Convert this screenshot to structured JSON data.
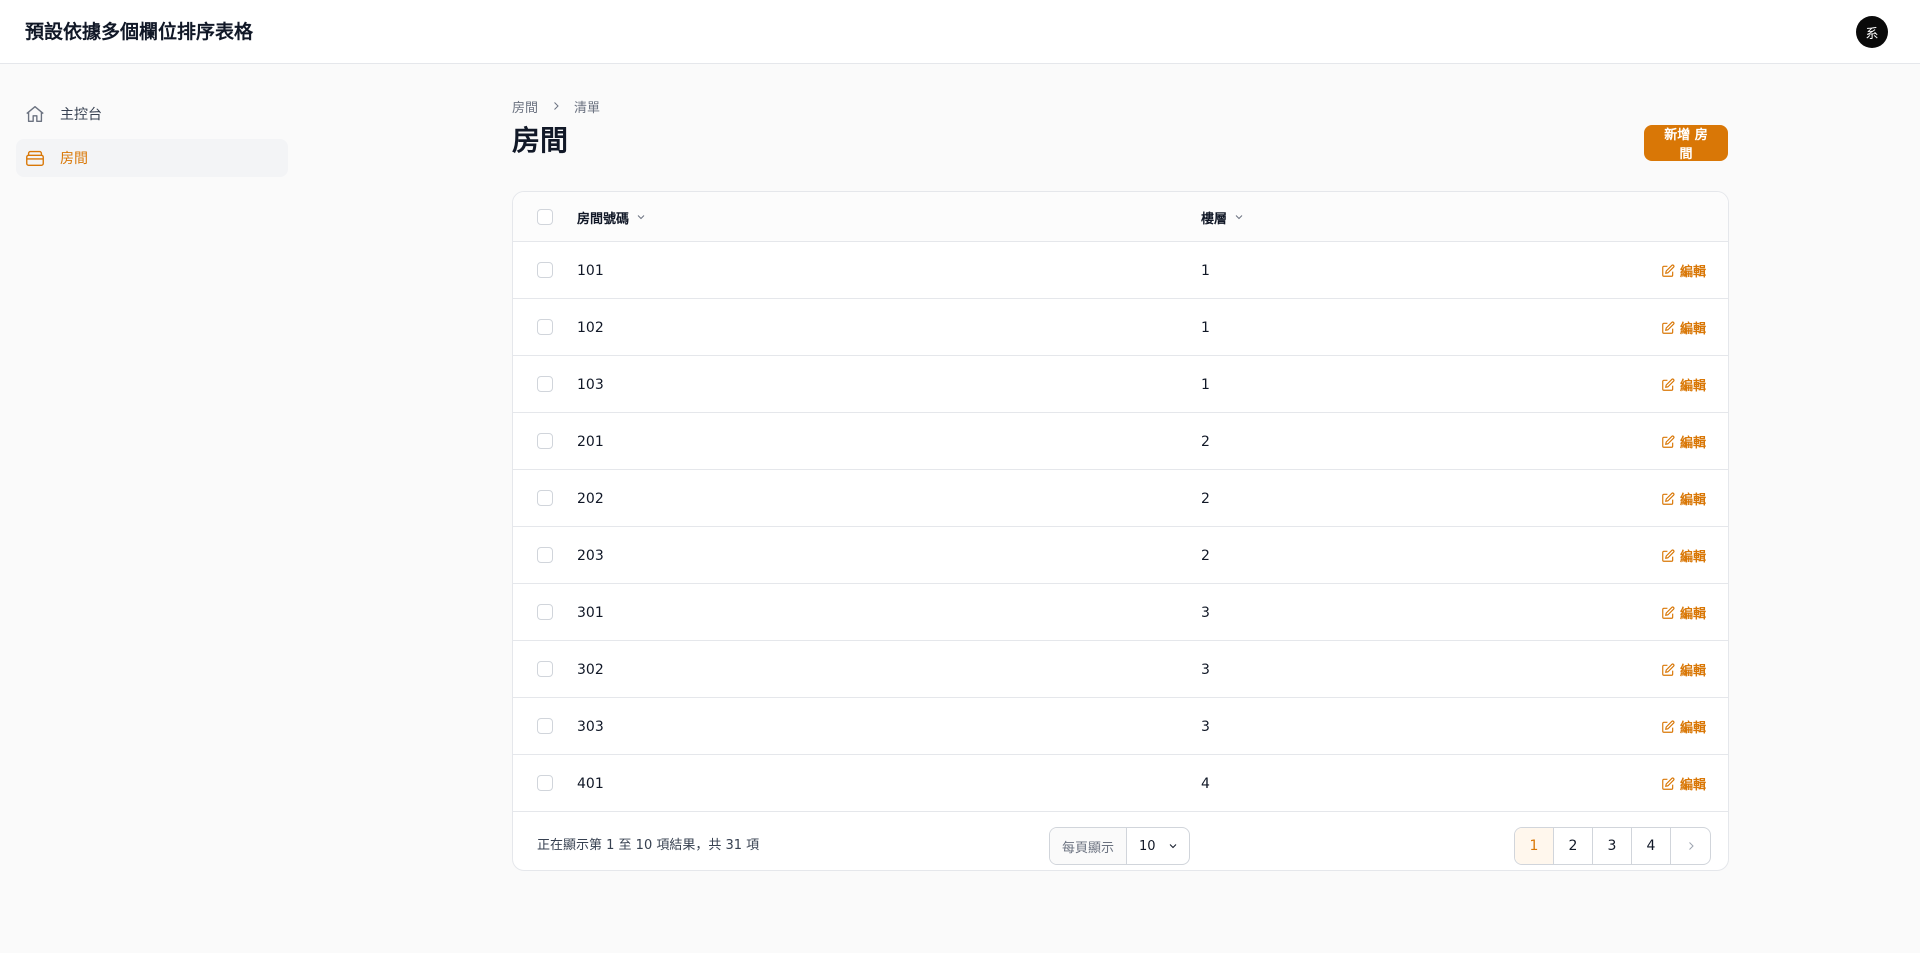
{
  "app": {
    "title": "預設依據多個欄位排序表格",
    "avatar_initial": "系"
  },
  "sidebar": {
    "items": [
      {
        "label": "主控台",
        "icon": "home-icon",
        "active": false
      },
      {
        "label": "房間",
        "icon": "rooms-icon",
        "active": true
      }
    ]
  },
  "breadcrumb": {
    "items": [
      "房間",
      "清單"
    ]
  },
  "page": {
    "title": "房間",
    "add_button_label": "新增 房間"
  },
  "table": {
    "columns": [
      {
        "label": "房間號碼",
        "sortable": true
      },
      {
        "label": "樓層",
        "sortable": true
      }
    ],
    "edit_label": "編輯",
    "rows": [
      {
        "room_number": "101",
        "floor": "1"
      },
      {
        "room_number": "102",
        "floor": "1"
      },
      {
        "room_number": "103",
        "floor": "1"
      },
      {
        "room_number": "201",
        "floor": "2"
      },
      {
        "room_number": "202",
        "floor": "2"
      },
      {
        "room_number": "203",
        "floor": "2"
      },
      {
        "room_number": "301",
        "floor": "3"
      },
      {
        "room_number": "302",
        "floor": "3"
      },
      {
        "room_number": "303",
        "floor": "3"
      },
      {
        "room_number": "401",
        "floor": "4"
      }
    ]
  },
  "pagination": {
    "summary": "正在顯示第 1 至 10 項結果，共 31 項",
    "per_page_label": "每頁顯示",
    "per_page_value": "10",
    "pages": [
      "1",
      "2",
      "3",
      "4"
    ],
    "current_page": "1"
  },
  "colors": {
    "accent": "#d97706",
    "border": "#e5e7eb",
    "background": "#fafafa"
  }
}
